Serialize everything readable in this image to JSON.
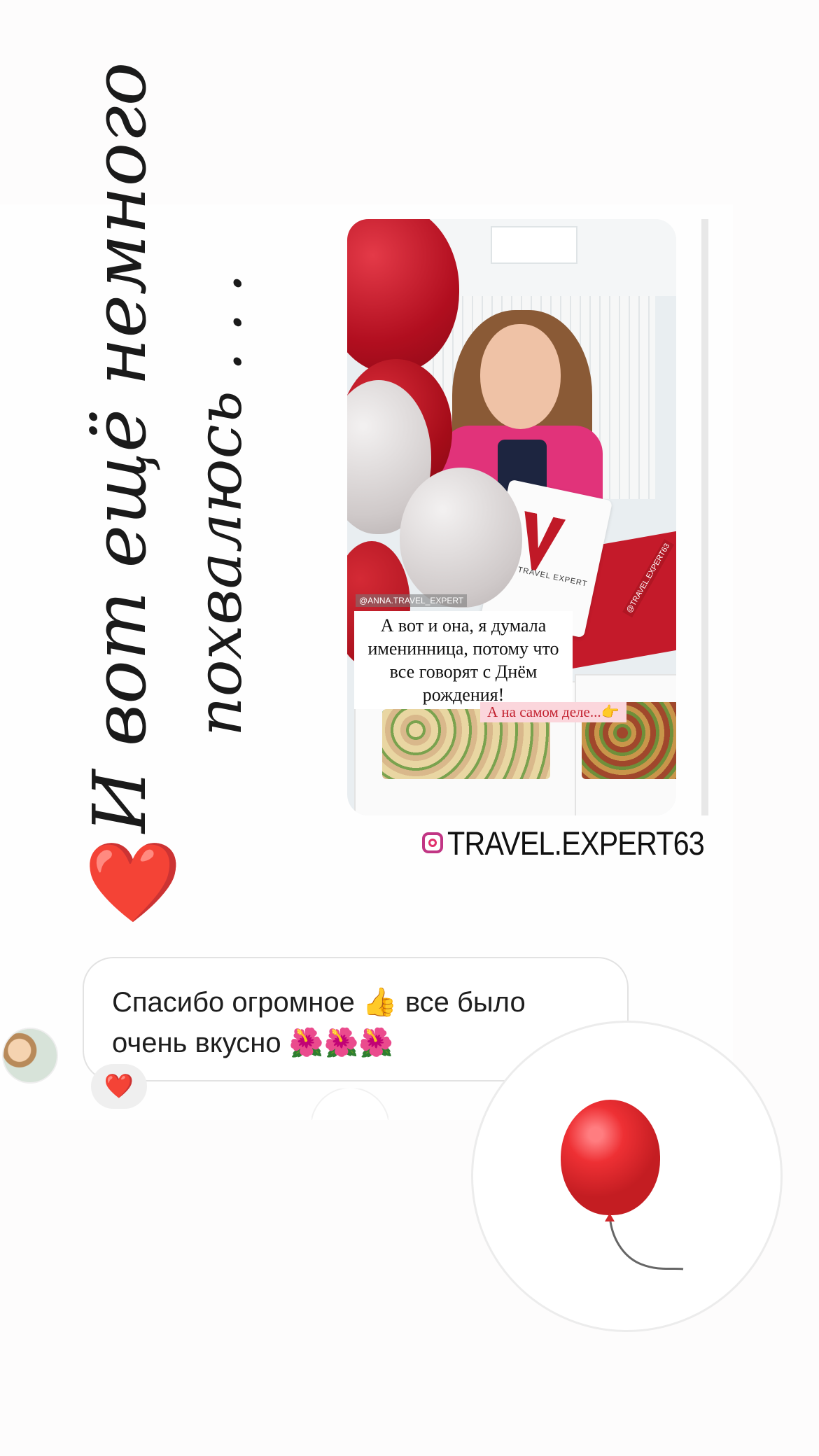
{
  "headline": {
    "line1": "И вот ещё немного",
    "line2": "похвалюсь . . ."
  },
  "story": {
    "photo_handle": "@ANNA.TRAVEL_EXPERT",
    "bag_label": "TRAVEL EXPERT",
    "desk_label": "@TRAVEL.EXPERT63",
    "caption": "А вот и она, я думала именинница, потому что все говорят с Днём рождения!",
    "caption2": "А на самом деле...👉"
  },
  "instagram": {
    "icon": "instagram-icon",
    "handle": "TRAVEL.EXPERT63"
  },
  "heart_emoji": "❤️",
  "message": {
    "text": "Спасибо огромное 👍 все было очень вкусно 🌺🌺🌺",
    "reaction": "❤️"
  },
  "sticker": {
    "icon": "balloon-icon"
  },
  "colors": {
    "accent_red": "#e0101e",
    "instagram_pink": "#e1306c",
    "caption_pink_bg": "#fbd6dc"
  }
}
